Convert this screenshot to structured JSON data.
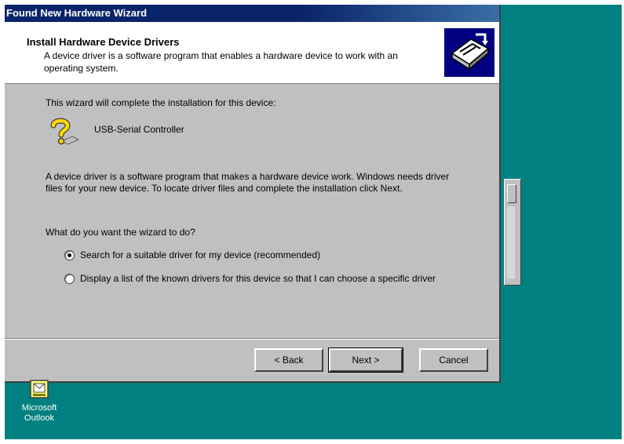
{
  "window": {
    "title": "Found New Hardware Wizard"
  },
  "header": {
    "title": "Install Hardware Device Drivers",
    "subtitle": "A device driver is a software program that enables a hardware device to work with an operating system.",
    "icon": "hardware-card-icon"
  },
  "body": {
    "intro": "This wizard will complete the installation for this device:",
    "device_name": "USB-Serial Controller",
    "device_icon": "unknown-device-icon",
    "explanation": "A device driver is a software program that makes a hardware device work. Windows needs driver files for your new device. To locate driver files and complete the installation click Next.",
    "question": "What do you want the wizard to do?",
    "options": [
      {
        "label": "Search for a suitable driver for my device (recommended)",
        "selected": true
      },
      {
        "label": "Display a list of the known drivers for this device so that I can choose a specific driver",
        "selected": false
      }
    ]
  },
  "buttons": {
    "back": "< Back",
    "next": "Next >",
    "cancel": "Cancel"
  },
  "desktop": {
    "icon_label": "Microsoft Outlook",
    "background_color": "#008080"
  }
}
